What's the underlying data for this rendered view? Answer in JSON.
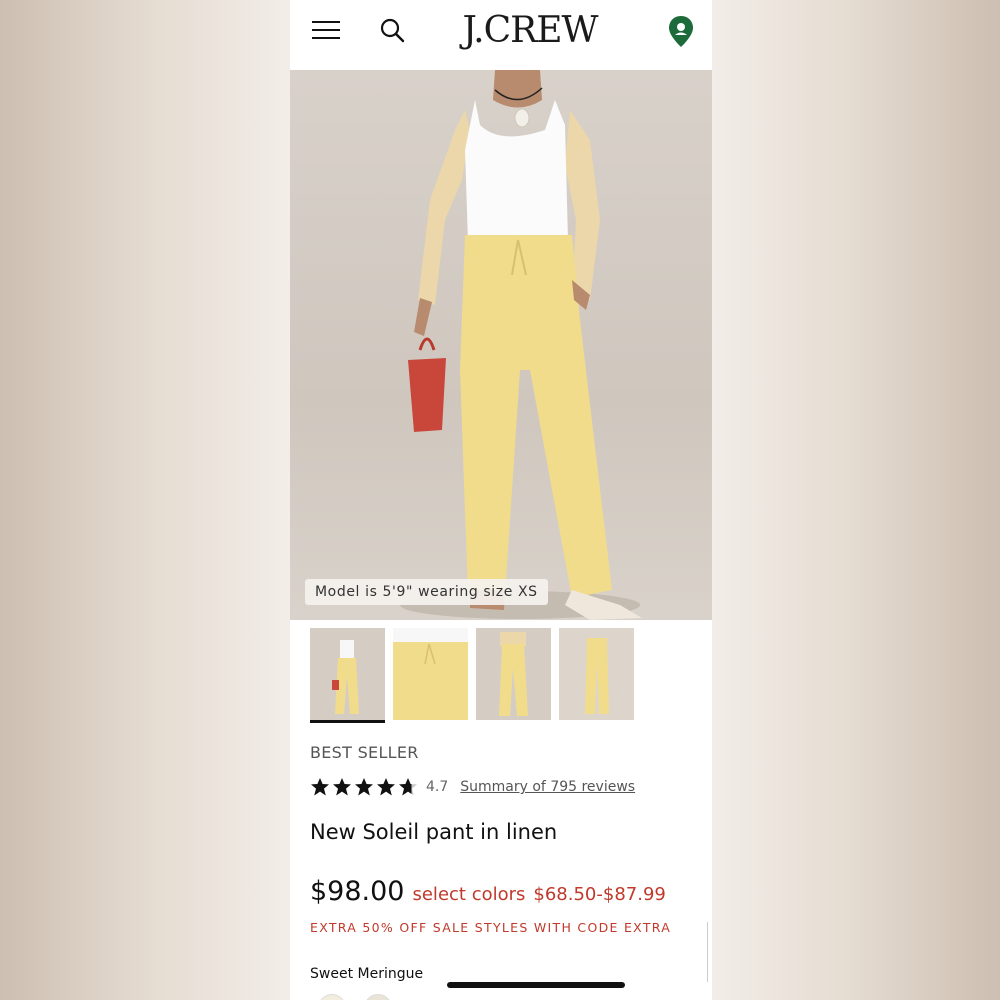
{
  "header": {
    "brand": "J.CREW",
    "icons": [
      "menu-icon",
      "search-icon",
      "location-pin-icon"
    ]
  },
  "hero": {
    "caption": "Model is 5'9\" wearing size XS"
  },
  "product": {
    "badge": "BEST SELLER",
    "rating": "4.7",
    "rating_fraction": 0.94,
    "reviews_link": "Summary of 795 reviews",
    "name": "New Soleil pant in linen",
    "price": "$98.00",
    "sale_label": "select colors",
    "sale_range": "$68.50-$87.99",
    "promo": "EXTRA 50% OFF SALE STYLES WITH CODE EXTRA",
    "color_name": "Sweet Meringue"
  },
  "colors": {
    "sale_red": "#c0392b",
    "pin_green": "#1d6b3a",
    "pant_yellow": "#f1dc8c",
    "bag_red": "#c9473a"
  }
}
